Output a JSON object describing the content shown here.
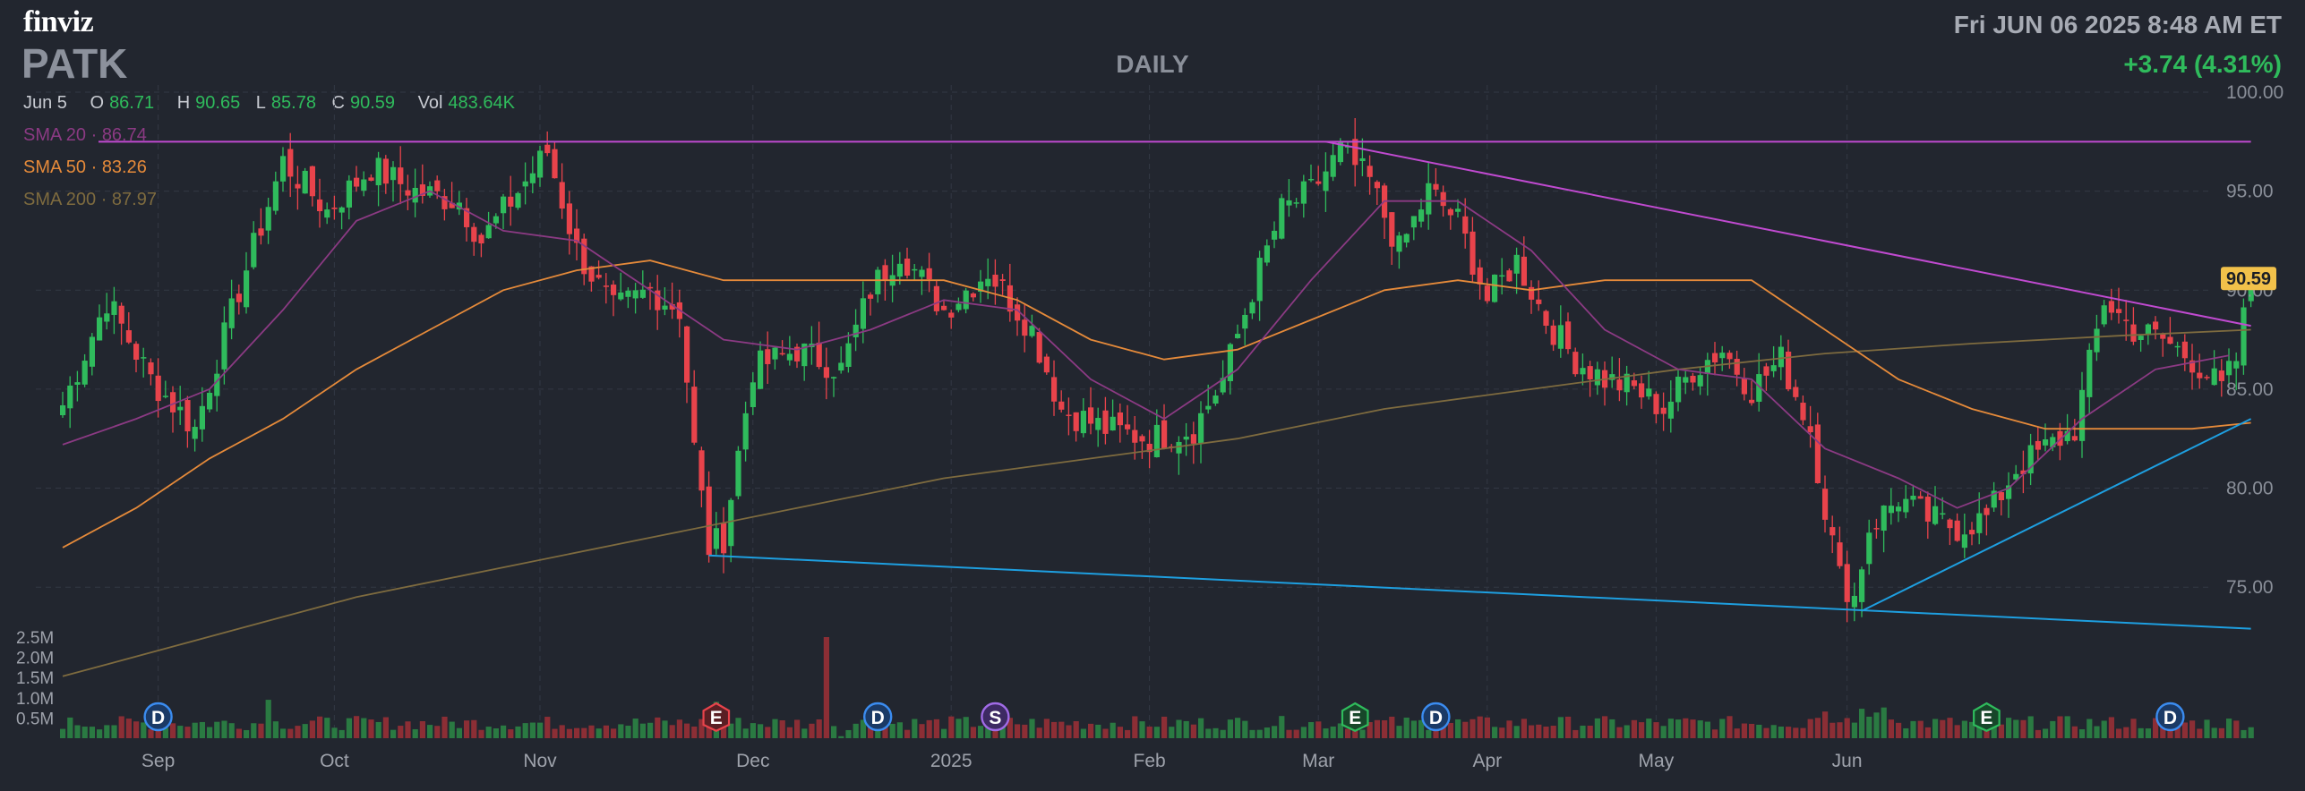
{
  "header": {
    "logo": "finviz",
    "ticker": "PATK",
    "timeframe": "DAILY",
    "datetime": "Fri JUN 06 2025 8:48 AM ET",
    "change": "+3.74 (4.31%)"
  },
  "ohlc": {
    "date": "Jun 5",
    "o_label": "O",
    "o": "86.71",
    "h_label": "H",
    "h": "90.65",
    "l_label": "L",
    "l": "85.78",
    "c_label": "C",
    "c": "90.59",
    "vol_label": "Vol",
    "vol": "483.64K"
  },
  "legend": {
    "sma20": "SMA 20 · 86.74",
    "sma50": "SMA 50 · 83.26",
    "sma200": "SMA 200 · 87.97"
  },
  "colors": {
    "up": "#2fbb5c",
    "down": "#e8434b",
    "sma20": "#8b3a83",
    "sma50": "#e58a3a",
    "sma200": "#7e6b3f",
    "resistance": "#c04ad0",
    "support": "#1e9fe0",
    "price_badge": "#f2c14a"
  },
  "chart_data": {
    "type": "candlestick",
    "title": "PATK",
    "x_labels": [
      "Sep",
      "Oct",
      "Nov",
      "Dec",
      "2025",
      "Feb",
      "Mar",
      "Apr",
      "May",
      "Jun"
    ],
    "y_ticks": [
      "100.00",
      "95.00",
      "90.00",
      "85.00",
      "80.00",
      "75.00"
    ],
    "ylim": [
      71,
      100
    ],
    "volume_ticks": [
      "2.5M",
      "2.0M",
      "1.5M",
      "1.0M",
      "0.5M"
    ],
    "last_price": "90.59",
    "events": [
      {
        "label": "D",
        "type": "dividend",
        "day": 13
      },
      {
        "label": "E",
        "type": "earnings-miss",
        "day": 89
      },
      {
        "label": "D",
        "type": "dividend",
        "day": 111
      },
      {
        "label": "S",
        "type": "split",
        "day": 127
      },
      {
        "label": "E",
        "type": "earnings-beat",
        "day": 176
      },
      {
        "label": "D",
        "type": "dividend",
        "day": 187
      },
      {
        "label": "E",
        "type": "earnings-beat",
        "day": 262
      },
      {
        "label": "D",
        "type": "dividend",
        "day": 287
      }
    ],
    "key_points": [
      {
        "x": 0,
        "y": 84.2
      },
      {
        "x": 6,
        "y": 89.5
      },
      {
        "x": 12,
        "y": 85.5
      },
      {
        "x": 18,
        "y": 83.0
      },
      {
        "x": 24,
        "y": 90.0
      },
      {
        "x": 30,
        "y": 96.5
      },
      {
        "x": 36,
        "y": 94.0
      },
      {
        "x": 42,
        "y": 96.2
      },
      {
        "x": 48,
        "y": 95.0
      },
      {
        "x": 54,
        "y": 94.5
      },
      {
        "x": 57,
        "y": 92.5
      },
      {
        "x": 62,
        "y": 95.0
      },
      {
        "x": 66,
        "y": 97.0
      },
      {
        "x": 70,
        "y": 92.0
      },
      {
        "x": 75,
        "y": 89.0
      },
      {
        "x": 80,
        "y": 90.0
      },
      {
        "x": 84,
        "y": 89.0
      },
      {
        "x": 86,
        "y": 82.0
      },
      {
        "x": 88,
        "y": 77.0
      },
      {
        "x": 90,
        "y": 77.5
      },
      {
        "x": 94,
        "y": 86.0
      },
      {
        "x": 100,
        "y": 87.0
      },
      {
        "x": 106,
        "y": 86.0
      },
      {
        "x": 110,
        "y": 90.0
      },
      {
        "x": 114,
        "y": 92.0
      },
      {
        "x": 120,
        "y": 89.0
      },
      {
        "x": 126,
        "y": 91.0
      },
      {
        "x": 132,
        "y": 88.0
      },
      {
        "x": 136,
        "y": 84.0
      },
      {
        "x": 142,
        "y": 83.0
      },
      {
        "x": 148,
        "y": 82.5
      },
      {
        "x": 154,
        "y": 83.0
      },
      {
        "x": 158,
        "y": 85.5
      },
      {
        "x": 162,
        "y": 90.0
      },
      {
        "x": 166,
        "y": 94.0
      },
      {
        "x": 170,
        "y": 95.0
      },
      {
        "x": 174,
        "y": 97.0
      },
      {
        "x": 178,
        "y": 95.5
      },
      {
        "x": 182,
        "y": 92.0
      },
      {
        "x": 186,
        "y": 95.0
      },
      {
        "x": 190,
        "y": 93.5
      },
      {
        "x": 194,
        "y": 89.5
      },
      {
        "x": 198,
        "y": 91.5
      },
      {
        "x": 202,
        "y": 88.5
      },
      {
        "x": 206,
        "y": 86.5
      },
      {
        "x": 210,
        "y": 85.5
      },
      {
        "x": 214,
        "y": 85.0
      },
      {
        "x": 218,
        "y": 84.0
      },
      {
        "x": 222,
        "y": 86.0
      },
      {
        "x": 226,
        "y": 87.0
      },
      {
        "x": 230,
        "y": 85.0
      },
      {
        "x": 234,
        "y": 86.5
      },
      {
        "x": 238,
        "y": 83.0
      },
      {
        "x": 240,
        "y": 79.0
      },
      {
        "x": 242,
        "y": 75.5
      },
      {
        "x": 244,
        "y": 74.5
      },
      {
        "x": 246,
        "y": 78.0
      },
      {
        "x": 250,
        "y": 79.5
      },
      {
        "x": 254,
        "y": 78.5
      },
      {
        "x": 258,
        "y": 78.0
      },
      {
        "x": 262,
        "y": 78.5
      },
      {
        "x": 266,
        "y": 81.0
      },
      {
        "x": 270,
        "y": 82.0
      },
      {
        "x": 274,
        "y": 83.0
      },
      {
        "x": 278,
        "y": 89.5
      },
      {
        "x": 282,
        "y": 88.0
      },
      {
        "x": 286,
        "y": 87.5
      },
      {
        "x": 290,
        "y": 86.5
      },
      {
        "x": 294,
        "y": 85.0
      },
      {
        "x": 296,
        "y": 86.5
      },
      {
        "x": 298,
        "y": 90.6
      }
    ],
    "sma20_points": [
      {
        "x": 0,
        "y": 82.2
      },
      {
        "x": 10,
        "y": 83.5
      },
      {
        "x": 20,
        "y": 85.0
      },
      {
        "x": 30,
        "y": 89.0
      },
      {
        "x": 40,
        "y": 93.5
      },
      {
        "x": 50,
        "y": 95.0
      },
      {
        "x": 60,
        "y": 93.0
      },
      {
        "x": 70,
        "y": 92.5
      },
      {
        "x": 80,
        "y": 90.0
      },
      {
        "x": 90,
        "y": 87.5
      },
      {
        "x": 100,
        "y": 87.0
      },
      {
        "x": 110,
        "y": 88.0
      },
      {
        "x": 120,
        "y": 89.5
      },
      {
        "x": 130,
        "y": 89.0
      },
      {
        "x": 140,
        "y": 85.5
      },
      {
        "x": 150,
        "y": 83.5
      },
      {
        "x": 160,
        "y": 86.0
      },
      {
        "x": 170,
        "y": 90.5
      },
      {
        "x": 180,
        "y": 94.5
      },
      {
        "x": 190,
        "y": 94.5
      },
      {
        "x": 200,
        "y": 92.0
      },
      {
        "x": 210,
        "y": 88.0
      },
      {
        "x": 220,
        "y": 86.0
      },
      {
        "x": 230,
        "y": 85.5
      },
      {
        "x": 240,
        "y": 82.0
      },
      {
        "x": 250,
        "y": 80.5
      },
      {
        "x": 258,
        "y": 79.0
      },
      {
        "x": 265,
        "y": 80.0
      },
      {
        "x": 275,
        "y": 83.5
      },
      {
        "x": 285,
        "y": 86.0
      },
      {
        "x": 295,
        "y": 86.7
      }
    ],
    "sma50_points": [
      {
        "x": 0,
        "y": 77.0
      },
      {
        "x": 10,
        "y": 79.0
      },
      {
        "x": 20,
        "y": 81.5
      },
      {
        "x": 30,
        "y": 83.5
      },
      {
        "x": 40,
        "y": 86.0
      },
      {
        "x": 50,
        "y": 88.0
      },
      {
        "x": 60,
        "y": 90.0
      },
      {
        "x": 70,
        "y": 91.0
      },
      {
        "x": 80,
        "y": 91.5
      },
      {
        "x": 90,
        "y": 90.5
      },
      {
        "x": 100,
        "y": 90.5
      },
      {
        "x": 110,
        "y": 90.5
      },
      {
        "x": 120,
        "y": 90.5
      },
      {
        "x": 130,
        "y": 89.5
      },
      {
        "x": 140,
        "y": 87.5
      },
      {
        "x": 150,
        "y": 86.5
      },
      {
        "x": 160,
        "y": 87.0
      },
      {
        "x": 170,
        "y": 88.5
      },
      {
        "x": 180,
        "y": 90.0
      },
      {
        "x": 190,
        "y": 90.5
      },
      {
        "x": 200,
        "y": 90.0
      },
      {
        "x": 210,
        "y": 90.5
      },
      {
        "x": 220,
        "y": 90.5
      },
      {
        "x": 230,
        "y": 90.5
      },
      {
        "x": 240,
        "y": 88.0
      },
      {
        "x": 250,
        "y": 85.5
      },
      {
        "x": 260,
        "y": 84.0
      },
      {
        "x": 270,
        "y": 83.0
      },
      {
        "x": 280,
        "y": 83.0
      },
      {
        "x": 290,
        "y": 83.0
      },
      {
        "x": 298,
        "y": 83.3
      }
    ],
    "sma200_points": [
      {
        "x": 0,
        "y": 70.5
      },
      {
        "x": 20,
        "y": 72.5
      },
      {
        "x": 40,
        "y": 74.5
      },
      {
        "x": 60,
        "y": 76.0
      },
      {
        "x": 80,
        "y": 77.5
      },
      {
        "x": 100,
        "y": 79.0
      },
      {
        "x": 120,
        "y": 80.5
      },
      {
        "x": 140,
        "y": 81.5
      },
      {
        "x": 160,
        "y": 82.5
      },
      {
        "x": 180,
        "y": 84.0
      },
      {
        "x": 200,
        "y": 85.0
      },
      {
        "x": 220,
        "y": 86.0
      },
      {
        "x": 240,
        "y": 86.8
      },
      {
        "x": 260,
        "y": 87.3
      },
      {
        "x": 280,
        "y": 87.7
      },
      {
        "x": 298,
        "y": 88.0
      }
    ],
    "trendlines": [
      {
        "name": "resistance-horizontal",
        "x1": -8,
        "y1": 97.5,
        "x2": 298,
        "y2": 97.5
      },
      {
        "name": "resistance-descending",
        "x1": 172,
        "y1": 97.5,
        "x2": 298,
        "y2": 88.2
      },
      {
        "name": "support-descending",
        "x1": 88,
        "y1": 76.6,
        "x2": 298,
        "y2": 72.9
      },
      {
        "name": "support-ascending",
        "x1": 245,
        "y1": 73.8,
        "x2": 298,
        "y2": 83.5
      }
    ]
  }
}
